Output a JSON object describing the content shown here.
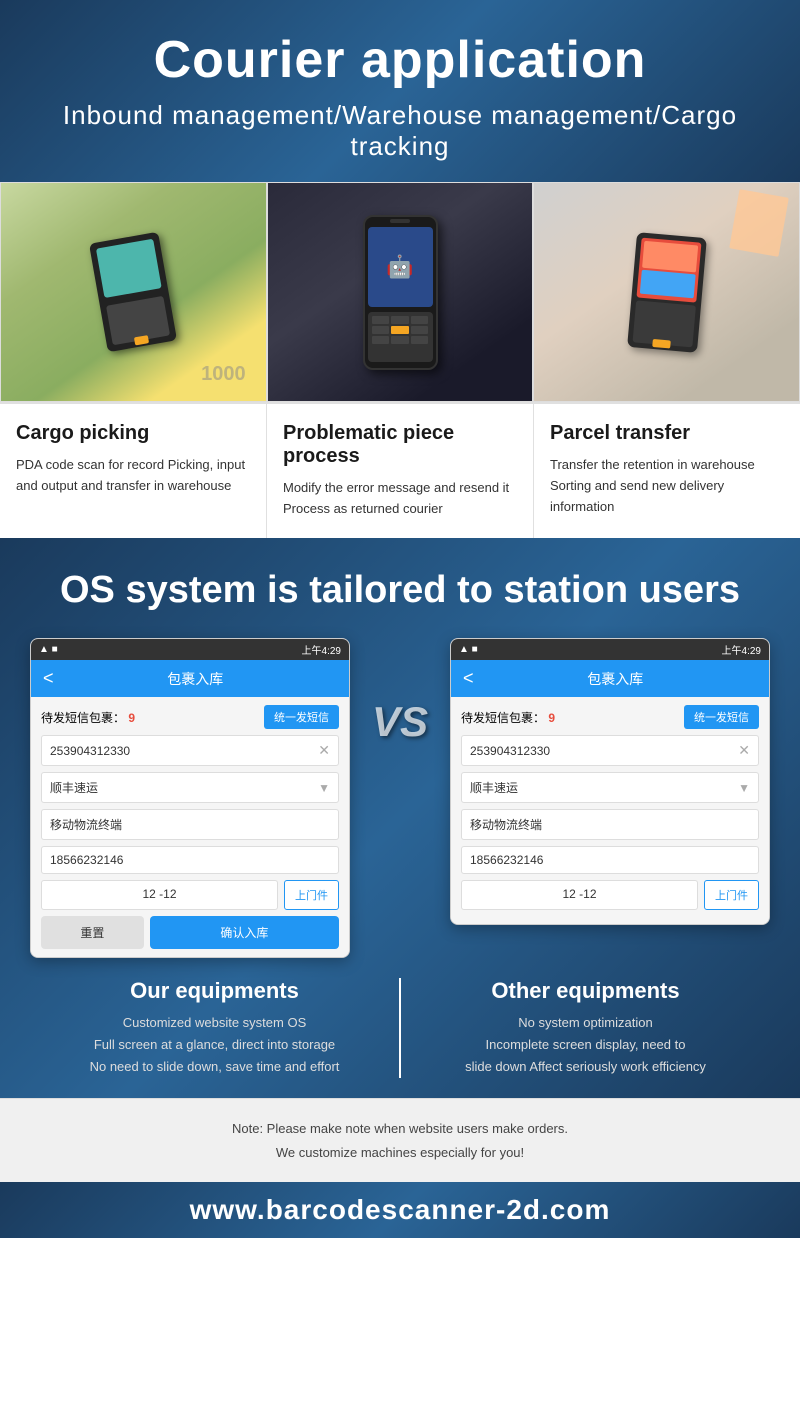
{
  "header": {
    "main_title": "Courier application",
    "subtitle": "Inbound management/Warehouse management/Cargo tracking"
  },
  "features": [
    {
      "id": "cargo-picking",
      "title": "Cargo picking",
      "description": "PDA code scan for record Picking, input and output and transfer in warehouse"
    },
    {
      "id": "problematic-piece",
      "title": "Problematic piece process",
      "description": "Modify the error message and resend it Process as returned courier"
    },
    {
      "id": "parcel-transfer",
      "title": "Parcel transfer",
      "description": "Transfer the retention in warehouse Sorting and send new delivery information"
    }
  ],
  "os_section": {
    "title": "OS system is tailored to station users"
  },
  "phone_screen": {
    "status_bar": "上午4:29",
    "nav_title": "包裹入库",
    "label_pending": "待发短信包裹：",
    "count_pending": "9",
    "btn_send_sms": "统一发短信",
    "tracking_number": "253904312330",
    "carrier": "顺丰速运",
    "device": "移动物流终端",
    "phone_number": "18566232146",
    "date": "12 -12",
    "tag": "上门件",
    "btn_reset": "重置",
    "btn_confirm": "确认入库"
  },
  "comparison": {
    "vs_text": "VS",
    "our_label": "Our equipments",
    "our_desc": "Customized website system OS\nFull screen at a glance, direct into storage\nNo need to slide down, save time and effort",
    "other_label": "Other equipments",
    "other_desc": "No system optimization\nIncomplete screen display, need to\nslide down Affect seriously work efficiency"
  },
  "note": {
    "line1": "Note: Please make note when website users make orders.",
    "line2": "We customize machines especially for you!"
  },
  "footer": {
    "url": "www.barcodescanner-2d.com"
  }
}
